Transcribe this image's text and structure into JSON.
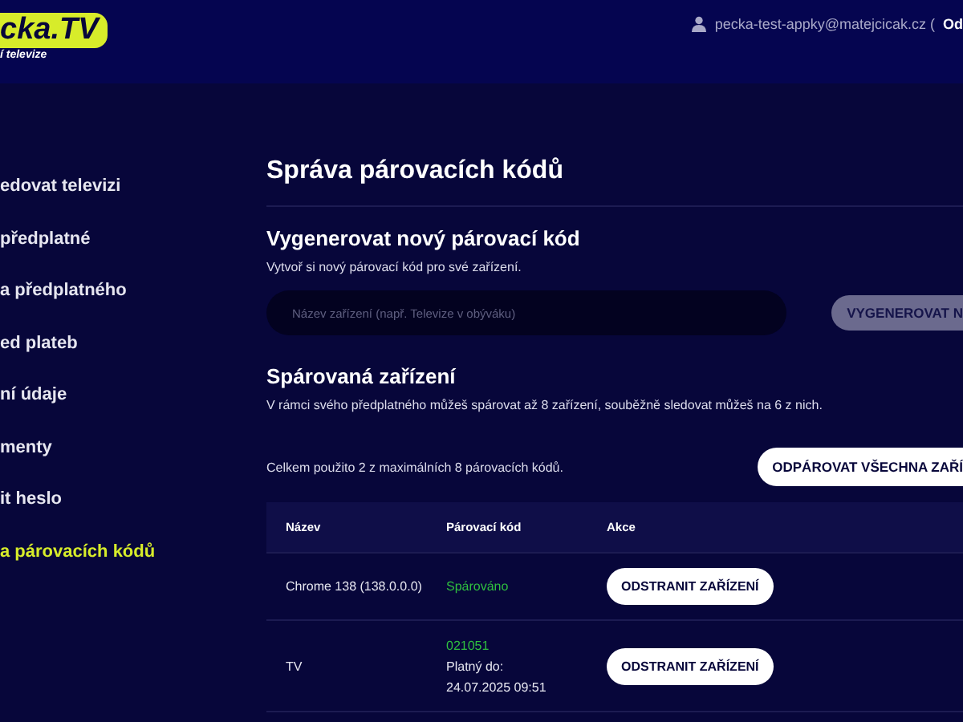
{
  "header": {
    "logo_text": "cka.TV",
    "logo_tagline": "í televize",
    "user_email": "pecka-test-appky@matejcicak.cz (",
    "logout_link": "Od"
  },
  "sidebar": {
    "items": [
      {
        "label": "edovat televizi",
        "selected": false
      },
      {
        "label": "předplatné",
        "selected": false
      },
      {
        "label": "a předplatného",
        "selected": false
      },
      {
        "label": "ed plateb",
        "selected": false
      },
      {
        "label": "ní údaje",
        "selected": false
      },
      {
        "label": "menty",
        "selected": false
      },
      {
        "label": "it heslo",
        "selected": false
      },
      {
        "label": "a párovacích kódů",
        "selected": true
      }
    ]
  },
  "page_title": "Správa párovacích kódů",
  "generate": {
    "title": "Vygenerovat nový párovací kód",
    "description": "Vytvoř si nový párovací kód pro své zařízení.",
    "placeholder": "Název zařízení (např. Televize v obýváku)",
    "button": {
      "label": "VYGENEROVAT N",
      "disabled": true
    }
  },
  "paired": {
    "title": "Spárovaná zařízení",
    "description": "V rámci svého předplatného můžeš spárovat až 8 zařízení, souběžně sledovat můžeš na 6 z nich.",
    "usage": "Celkem použito 2 z maximálních 8 párovacích kódů.",
    "unpair_all_button": "ODPÁROVAT VŠECHNA ZAŘÍ"
  },
  "table": {
    "columns": [
      "Název",
      "Párovací kód",
      "Akce"
    ],
    "rows": [
      {
        "name": "Chrome 138 (138.0.0.0)",
        "kind": "paired",
        "status": "Spárováno",
        "action": "ODSTRANIT ZAŘÍZENÍ"
      },
      {
        "name": "TV",
        "kind": "code",
        "code": "021051",
        "valid_label": "Platný do:",
        "valid_until": "24.07.2025 09:51",
        "action": "ODSTRANIT ZAŘÍZENÍ"
      }
    ]
  }
}
